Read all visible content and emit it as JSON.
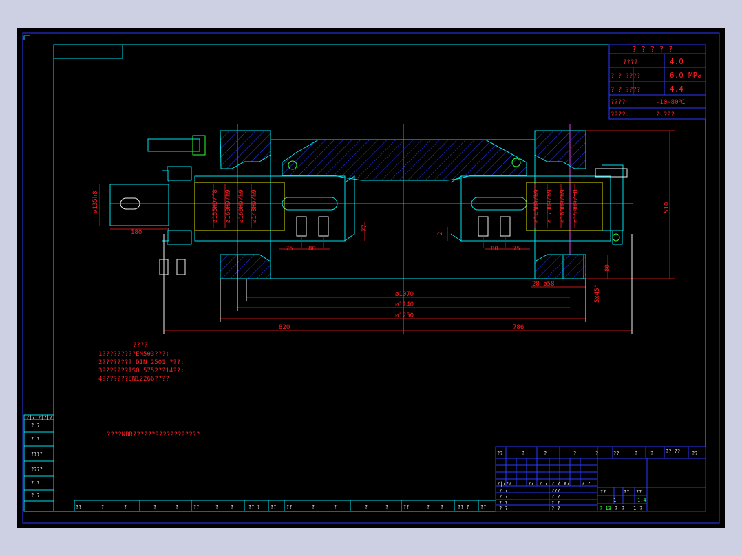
{
  "spec_table": {
    "title": "? ? ? ? ?",
    "rows": [
      {
        "label": "????",
        "value": "4.0"
      },
      {
        "label": "?  ?  ????",
        "value": "6.0",
        "unit": "MPa"
      },
      {
        "label": "?  ?  ????",
        "value": "4.4"
      },
      {
        "label": "????",
        "value": "-10~80℃"
      },
      {
        "label": "????.",
        "value": "?.???"
      }
    ]
  },
  "dimensions": {
    "shaft_diameter": "ø135h8",
    "shaft_length": "180",
    "left_fits": [
      "ø155H9/f8",
      "ø160H9/h9",
      "ø160H9/h9",
      "ø148H9/h9"
    ],
    "right_fits": [
      "ø148H9/h9",
      "ø170H9/h9",
      "ø160H9/h9",
      "ø159H9/f8"
    ],
    "left_spacing": [
      "75",
      "80"
    ],
    "right_spacing": [
      "80",
      "75"
    ],
    "web_height": "77",
    "gap": "2",
    "bolt_circle_inner": "ø1070",
    "bolt_circle_mid": "ø1140",
    "flange_outer": "ø1250",
    "left_length": "820",
    "right_length": "786",
    "holes": "28-ø58",
    "flange_thickness": "80",
    "chamfer": "5x45°",
    "height": "510"
  },
  "notes": {
    "title": "????",
    "items": [
      "1?????????EN5θ3???;",
      "2????????  DIN 2501 ???;",
      "3???????ISO 5752??14??;",
      "4???????EN12266????"
    ],
    "extra": "????NBR??????????????????"
  },
  "left_table": [
    "?|?|?|?|?",
    "?  ?",
    "?  ?",
    "????",
    "????",
    "?  ?",
    "?  ?"
  ],
  "bottom_strip": [
    "??",
    "?",
    "?",
    "?",
    "?",
    "??",
    "?",
    "?",
    "?? ?",
    "??",
    "??",
    "?",
    "?",
    "?",
    "?",
    "??",
    "?",
    "?",
    "?? ?",
    "??"
  ],
  "title_block": {
    "header": [
      "??",
      "?",
      "?",
      "?",
      "?",
      "??",
      "?",
      "?",
      "?? ??",
      "??"
    ],
    "revision_cols": [
      "?|???",
      "??",
      "? ?",
      "? ? ?",
      "??",
      "? ?"
    ],
    "signatures": [
      "? ?",
      "? ?",
      "? ?",
      "? ?"
    ],
    "checks": [
      "???",
      "? ?",
      "? ?",
      "? ?"
    ],
    "props": [
      "??",
      "??",
      "??",
      "1",
      "1:4"
    ],
    "sheet": [
      "? 13",
      "?",
      "?",
      "1",
      "?",
      "1",
      "?"
    ]
  }
}
